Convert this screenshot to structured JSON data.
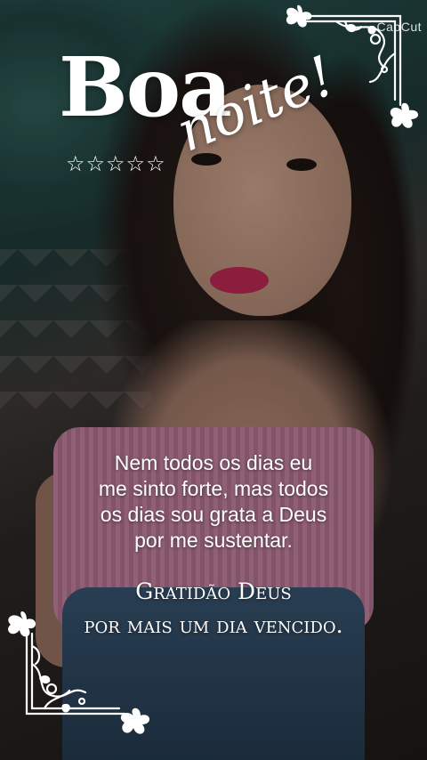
{
  "watermark": {
    "text": "CapCut"
  },
  "title": {
    "line1": "Boa",
    "line2": "noite!"
  },
  "stars": {
    "count": 5,
    "symbol": "☆"
  },
  "message": {
    "lines": [
      "Nem todos os dias eu",
      "me sinto forte, mas todos",
      "os dias sou grata a Deus",
      "por me sustentar."
    ]
  },
  "gratitude": {
    "lines": [
      "Gratidão Deus",
      "por mais um dia vencido."
    ]
  },
  "ornaments": {
    "top_right": "floral-corner-icon",
    "bottom_left": "floral-corner-icon"
  },
  "colors": {
    "text": "#ffffff",
    "lips": "#b2264f",
    "top": "#b97b98",
    "background_teal": "#26514d"
  }
}
